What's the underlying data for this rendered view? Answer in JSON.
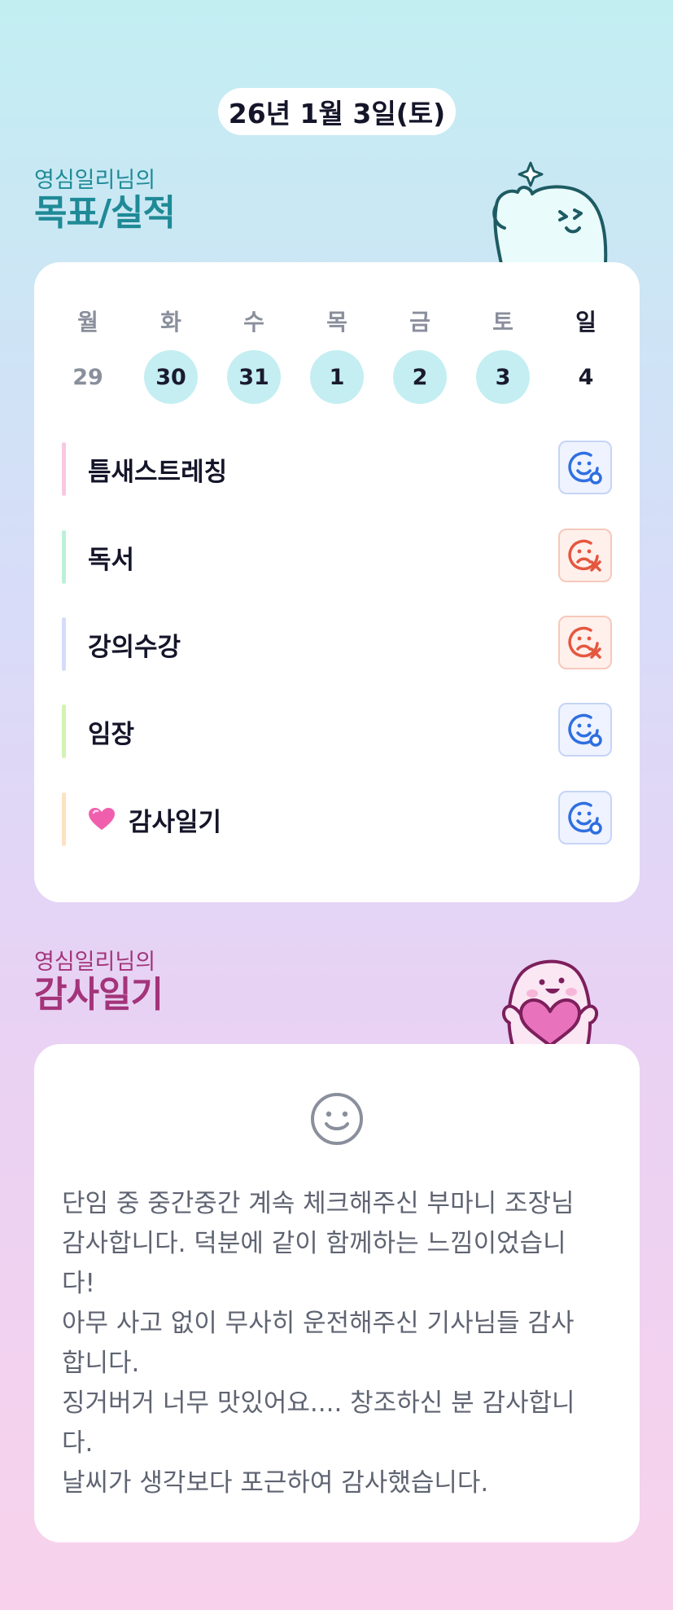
{
  "date_label": "26년 1월 3일(토)",
  "goals_section": {
    "subtitle": "영심일리님의",
    "title": "목표/실적"
  },
  "week": {
    "days": [
      {
        "name": "월",
        "num": "29",
        "state": "dim"
      },
      {
        "name": "화",
        "num": "30",
        "state": "filled"
      },
      {
        "name": "수",
        "num": "31",
        "state": "filled"
      },
      {
        "name": "목",
        "num": "1",
        "state": "filled"
      },
      {
        "name": "금",
        "num": "2",
        "state": "filled"
      },
      {
        "name": "토",
        "num": "3",
        "state": "filled"
      },
      {
        "name": "일",
        "num": "4",
        "state": "today"
      }
    ]
  },
  "goals": [
    {
      "label": "틈새스트레칭",
      "status": "done",
      "bar_color": "#f9c8e2"
    },
    {
      "label": "독서",
      "status": "fail",
      "bar_color": "#bdf0d8"
    },
    {
      "label": "강의수강",
      "status": "fail",
      "bar_color": "#d3dcfb"
    },
    {
      "label": "임장",
      "status": "done",
      "bar_color": "#d3f2b4"
    },
    {
      "label": "감사일기",
      "status": "done",
      "bar_color": "#fde2c0",
      "icon": "heart-icon"
    }
  ],
  "thanks_section": {
    "subtitle": "영심일리님의",
    "title": "감사일기"
  },
  "thanks_text": "단임 중 중간중간 계속 체크해주신 부마니 조장님\n감사합니다. 덕분에 같이 함께하는 느낌이었습니\n다!\n아무 사고 없이 무사히 운전해주신 기사님들 감사\n합니다.\n징거버거 너무 맛있어요.... 창조하신 분 감사합니\n다.\n날씨가 생각보다 포근하여 감사했습니다.",
  "colors": {
    "goal_heading": "#1f8a96",
    "thanks_heading": "#a3347a",
    "done_icon": "#2f6fe0",
    "fail_icon": "#e4573f",
    "date_circle": "#c4eef2"
  }
}
